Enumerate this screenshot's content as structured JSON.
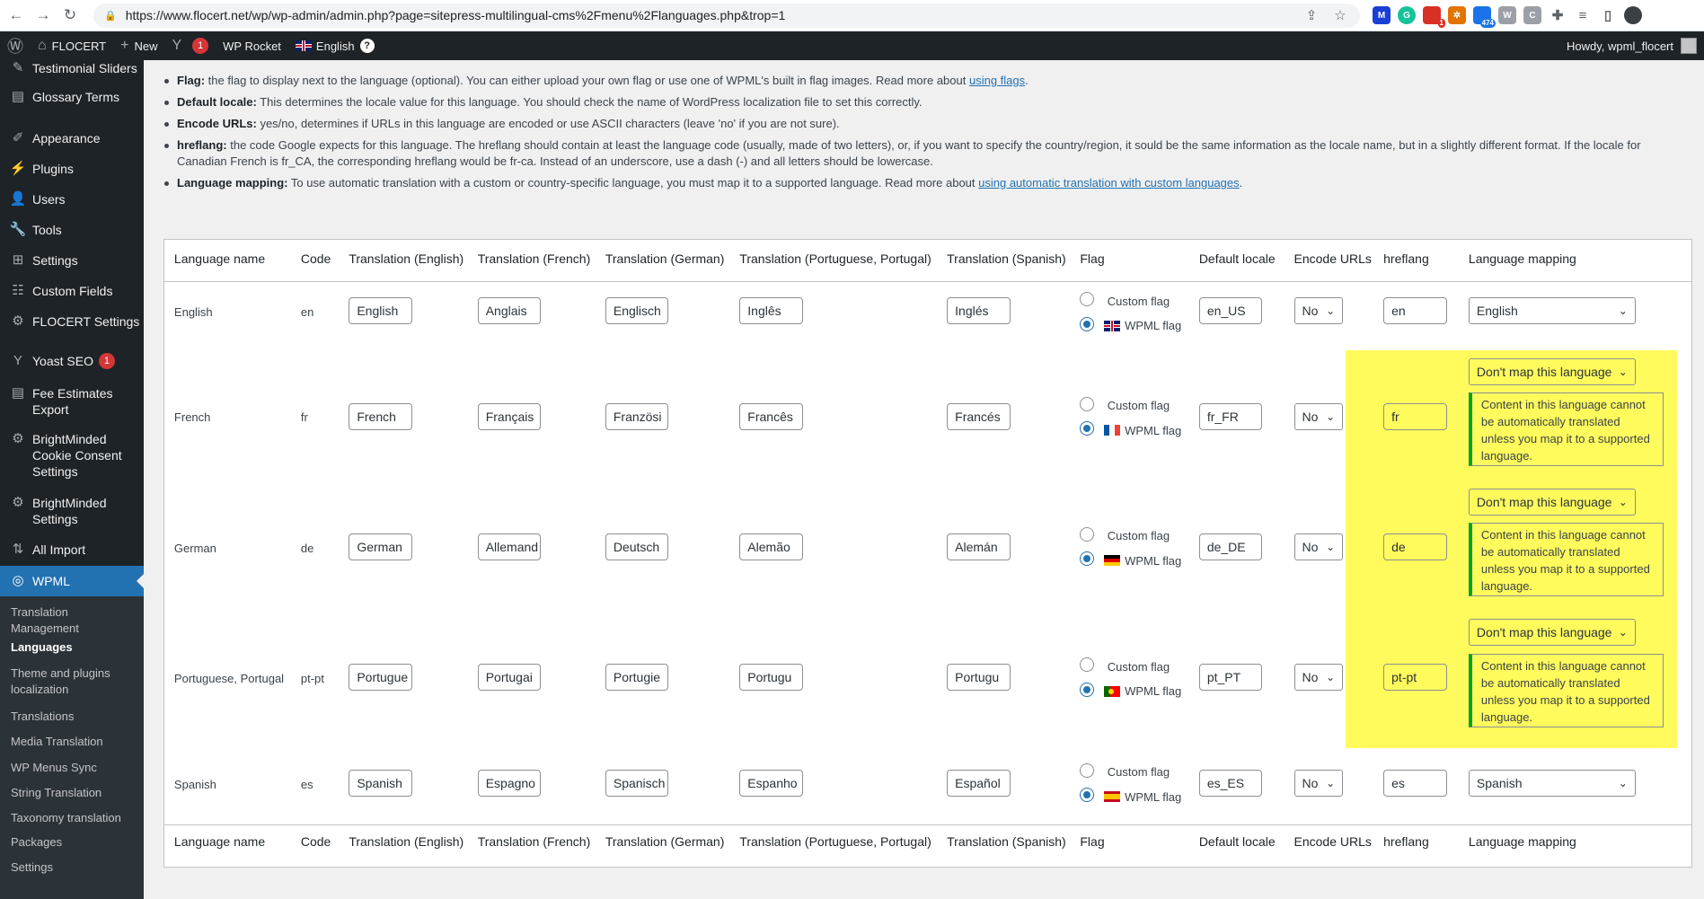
{
  "browser": {
    "url": "https://www.flocert.net/wp/wp-admin/admin.php?page=sitepress-multilingual-cms%2Fmenu%2Flanguages.php&trop=1",
    "ext_badges": [
      "1",
      "474"
    ]
  },
  "adminbar": {
    "site": "FLOCERT",
    "new": "New",
    "yoast_count": "1",
    "rocket": "WP Rocket",
    "lang": "English",
    "help": "?",
    "howdy": "Howdy, wpml_flocert"
  },
  "sidebar": {
    "items": [
      {
        "label": "Testimonial Sliders"
      },
      {
        "label": "Glossary Terms"
      },
      {
        "label": "Appearance"
      },
      {
        "label": "Plugins"
      },
      {
        "label": "Users"
      },
      {
        "label": "Tools"
      },
      {
        "label": "Settings"
      },
      {
        "label": "Custom Fields"
      },
      {
        "label": "FLOCERT Settings"
      },
      {
        "label": "Yoast SEO",
        "badge": "1"
      },
      {
        "label": "Fee Estimates Export"
      },
      {
        "label": "BrightMinded Cookie Consent Settings"
      },
      {
        "label": "BrightMinded Settings"
      },
      {
        "label": "All Import"
      },
      {
        "label": "WPML"
      }
    ],
    "submenu": [
      "Translation Management",
      "Languages",
      "Theme and plugins localization",
      "Translations",
      "Media Translation",
      "WP Menus Sync",
      "String Translation",
      "Taxonomy translation",
      "Packages",
      "Settings"
    ]
  },
  "help": {
    "flag_b": "Flag:",
    "flag_t": " the flag to display next to the language (optional). You can either upload your own flag or use one of WPML's built in flag images. Read more about ",
    "flag_link": "using flags",
    "flag_end": ".",
    "locale_b": "Default locale:",
    "locale_t": " This determines the locale value for this language. You should check the name of WordPress localization file to set this correctly.",
    "enc_b": "Encode URLs:",
    "enc_t": " yes/no, determines if URLs in this language are encoded or use ASCII characters (leave 'no' if you are not sure).",
    "href_b": "hreflang:",
    "href_t1": " the code Google expects for this language. The hreflang should contain at least the language code (usually, made of two letters), or, if you want to specify the country/region, it sould be the same information as the locale name, but in a slightly different format. If the locale for",
    "href_t2": "Canadian French is fr_CA, the corresponding hreflang would be fr-ca. Instead of an underscore, use a dash (-) and all letters should be lowercase.",
    "map_b": "Language mapping:",
    "map_t": " To use automatic translation with a custom or country-specific language, you must map it to a supported language. Read more about ",
    "map_link": "using automatic translation with custom languages",
    "map_end": "."
  },
  "table": {
    "headers": [
      "Language name",
      "Code",
      "Translation (English)",
      "Translation (French)",
      "Translation (German)",
      "Translation (Portuguese, Portugal)",
      "Translation (Spanish)",
      "Flag",
      "Default locale",
      "Encode URLs",
      "hreflang",
      "Language mapping"
    ],
    "custom_flag": "Custom flag",
    "wpml_flag": "WPML flag",
    "dont_map": "Don't map this language",
    "warning": "Content in this language cannot be automatically translated unless you map it to a supported language.",
    "rows": [
      {
        "name": "English",
        "code": "en",
        "tr": [
          "English",
          "Anglais",
          "Englisch",
          "Inglês",
          "Inglés"
        ],
        "locale": "en_US",
        "enc": "No",
        "hreflang": "en",
        "mapping": "English"
      },
      {
        "name": "French",
        "code": "fr",
        "tr": [
          "French",
          "Français",
          "Französi",
          "Francês",
          "Francés"
        ],
        "locale": "fr_FR",
        "enc": "No",
        "hreflang": "fr",
        "mapping": "Don't map this language"
      },
      {
        "name": "German",
        "code": "de",
        "tr": [
          "German",
          "Allemand",
          "Deutsch",
          "Alemão",
          "Alemán"
        ],
        "locale": "de_DE",
        "enc": "No",
        "hreflang": "de",
        "mapping": "Don't map this language"
      },
      {
        "name": "Portuguese, Portugal",
        "code": "pt-pt",
        "tr": [
          "Portugue",
          "Portugai",
          "Portugie",
          "Portugu",
          "Portugu"
        ],
        "locale": "pt_PT",
        "enc": "No",
        "hreflang": "pt-pt",
        "mapping": "Don't map this language"
      },
      {
        "name": "Spanish",
        "code": "es",
        "tr": [
          "Spanish",
          "Espagno",
          "Spanisch",
          "Espanho",
          "Español"
        ],
        "locale": "es_ES",
        "enc": "No",
        "hreflang": "es",
        "mapping": "Spanish"
      }
    ]
  }
}
